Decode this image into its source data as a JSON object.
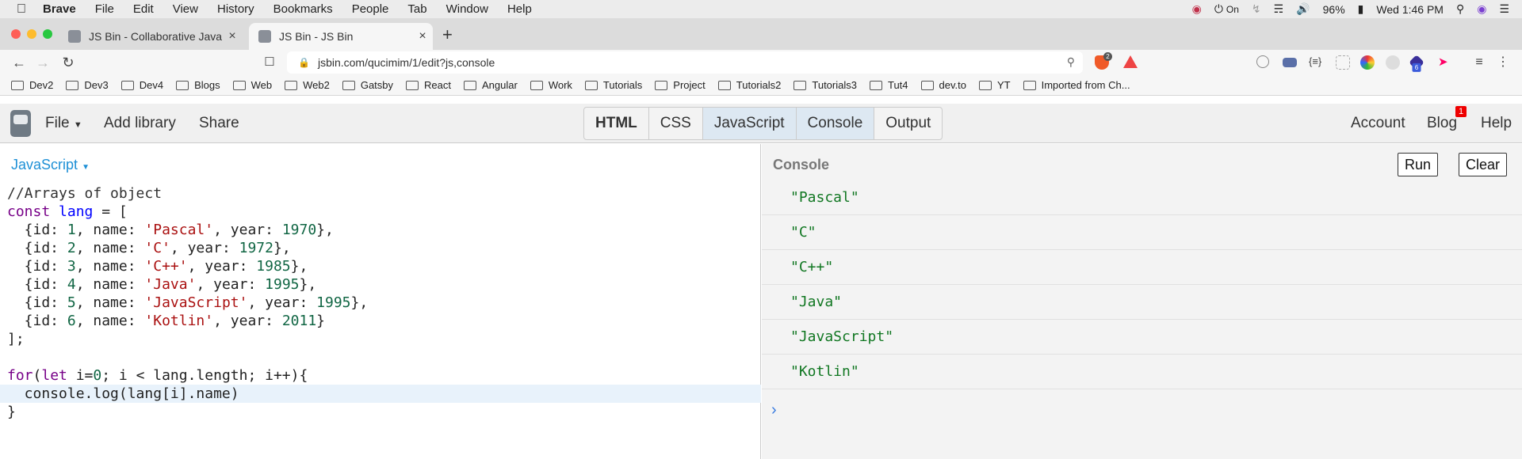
{
  "menubar": {
    "app_name": "Brave",
    "items": [
      "File",
      "Edit",
      "View",
      "History",
      "Bookmarks",
      "People",
      "Tab",
      "Window",
      "Help"
    ],
    "status": {
      "vpn": "On",
      "battery": "96%",
      "datetime": "Wed 1:46 PM"
    }
  },
  "tabs": [
    {
      "title": "JS Bin - Collaborative JavaScript Debugging",
      "active": false
    },
    {
      "title": "JS Bin - JS Bin",
      "active": true
    }
  ],
  "address_bar": {
    "url": "jsbin.com/qucimim/1/edit?js,console"
  },
  "extensions": {
    "shield_count": "2",
    "ext_badge": "6"
  },
  "bookmarks": [
    "Dev2",
    "Dev3",
    "Dev4",
    "Blogs",
    "Web",
    "Web2",
    "Gatsby",
    "React",
    "Angular",
    "Work",
    "Tutorials",
    "Project",
    "Tutorials2",
    "Tutorials3",
    "Tut4",
    "dev.to",
    "YT",
    "Imported from Ch..."
  ],
  "jsbin_header": {
    "file": "File",
    "add_library": "Add library",
    "share": "Share",
    "panels": [
      {
        "label": "HTML",
        "state": "bold"
      },
      {
        "label": "CSS",
        "state": "normal"
      },
      {
        "label": "JavaScript",
        "state": "active"
      },
      {
        "label": "Console",
        "state": "active"
      },
      {
        "label": "Output",
        "state": "normal"
      }
    ],
    "account": "Account",
    "blog": "Blog",
    "blog_badge": "1",
    "help": "Help"
  },
  "editor": {
    "language_label": "JavaScript",
    "highlighted_line": 11,
    "code": [
      [
        [
          "comment",
          "//Arrays of object"
        ]
      ],
      [
        [
          "keyword",
          "const"
        ],
        [
          "plain",
          " "
        ],
        [
          "var",
          "lang"
        ],
        [
          "plain",
          " = ["
        ]
      ],
      [
        [
          "plain",
          "  {id: "
        ],
        [
          "number",
          "1"
        ],
        [
          "plain",
          ", name: "
        ],
        [
          "string",
          "'Pascal'"
        ],
        [
          "plain",
          ", year: "
        ],
        [
          "number",
          "1970"
        ],
        [
          "plain",
          "},"
        ]
      ],
      [
        [
          "plain",
          "  {id: "
        ],
        [
          "number",
          "2"
        ],
        [
          "plain",
          ", name: "
        ],
        [
          "string",
          "'C'"
        ],
        [
          "plain",
          ", year: "
        ],
        [
          "number",
          "1972"
        ],
        [
          "plain",
          "},"
        ]
      ],
      [
        [
          "plain",
          "  {id: "
        ],
        [
          "number",
          "3"
        ],
        [
          "plain",
          ", name: "
        ],
        [
          "string",
          "'C++'"
        ],
        [
          "plain",
          ", year: "
        ],
        [
          "number",
          "1985"
        ],
        [
          "plain",
          "},"
        ]
      ],
      [
        [
          "plain",
          "  {id: "
        ],
        [
          "number",
          "4"
        ],
        [
          "plain",
          ", name: "
        ],
        [
          "string",
          "'Java'"
        ],
        [
          "plain",
          ", year: "
        ],
        [
          "number",
          "1995"
        ],
        [
          "plain",
          "},"
        ]
      ],
      [
        [
          "plain",
          "  {id: "
        ],
        [
          "number",
          "5"
        ],
        [
          "plain",
          ", name: "
        ],
        [
          "string",
          "'JavaScript'"
        ],
        [
          "plain",
          ", year: "
        ],
        [
          "number",
          "1995"
        ],
        [
          "plain",
          "},"
        ]
      ],
      [
        [
          "plain",
          "  {id: "
        ],
        [
          "number",
          "6"
        ],
        [
          "plain",
          ", name: "
        ],
        [
          "string",
          "'Kotlin'"
        ],
        [
          "plain",
          ", year: "
        ],
        [
          "number",
          "2011"
        ],
        [
          "plain",
          "}"
        ]
      ],
      [
        [
          "plain",
          "];"
        ]
      ],
      [],
      [
        [
          "keyword",
          "for"
        ],
        [
          "plain",
          "("
        ],
        [
          "keyword",
          "let"
        ],
        [
          "plain",
          " i="
        ],
        [
          "number",
          "0"
        ],
        [
          "plain",
          "; i < lang.length; i++){"
        ]
      ],
      [
        [
          "plain",
          "  console.log(lang[i].name)"
        ]
      ],
      [
        [
          "plain",
          "}"
        ]
      ]
    ]
  },
  "console": {
    "title": "Console",
    "run_label": "Run",
    "clear_label": "Clear",
    "logs": [
      "\"Pascal\"",
      "\"C\"",
      "\"C++\"",
      "\"Java\"",
      "\"JavaScript\"",
      "\"Kotlin\""
    ],
    "prompt": "›"
  }
}
